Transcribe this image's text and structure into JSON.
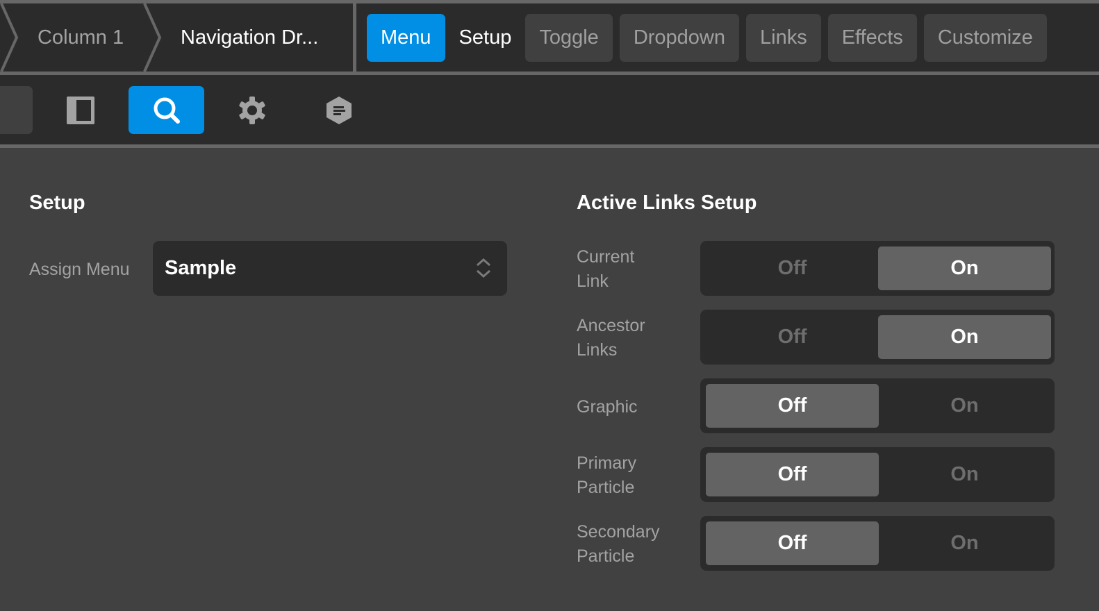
{
  "breadcrumb": {
    "items": [
      {
        "label": "Column 1"
      },
      {
        "label": "Navigation Dr..."
      }
    ]
  },
  "tabs": [
    {
      "label": "Menu",
      "state": "active"
    },
    {
      "label": "Setup",
      "state": "plain"
    },
    {
      "label": "Toggle",
      "state": "inactive"
    },
    {
      "label": "Dropdown",
      "state": "inactive"
    },
    {
      "label": "Links",
      "state": "inactive"
    },
    {
      "label": "Effects",
      "state": "inactive"
    },
    {
      "label": "Customize",
      "state": "inactive"
    }
  ],
  "toolbar": {
    "items": [
      {
        "icon": "panel-layout-icon"
      },
      {
        "icon": "search-icon",
        "active": true
      },
      {
        "icon": "gear-icon"
      },
      {
        "icon": "hexagon-text-icon"
      }
    ]
  },
  "setup": {
    "title": "Setup",
    "assign_menu_label": "Assign Menu",
    "assign_menu_value": "Sample"
  },
  "active_links": {
    "title": "Active Links Setup",
    "off_label": "Off",
    "on_label": "On",
    "rows": [
      {
        "label_line1": "Current",
        "label_line2": "Link",
        "value": "On"
      },
      {
        "label_line1": "Ancestor",
        "label_line2": "Links",
        "value": "On"
      },
      {
        "label_line1": "Graphic",
        "label_line2": "",
        "value": "Off"
      },
      {
        "label_line1": "Primary",
        "label_line2": "Particle",
        "value": "Off"
      },
      {
        "label_line1": "Secondary",
        "label_line2": "Particle",
        "value": "Off"
      }
    ]
  },
  "colors": {
    "accent": "#008fe5",
    "bar_bg": "#2b2b2b",
    "content_bg": "#414141",
    "selected_segment": "#636363"
  }
}
